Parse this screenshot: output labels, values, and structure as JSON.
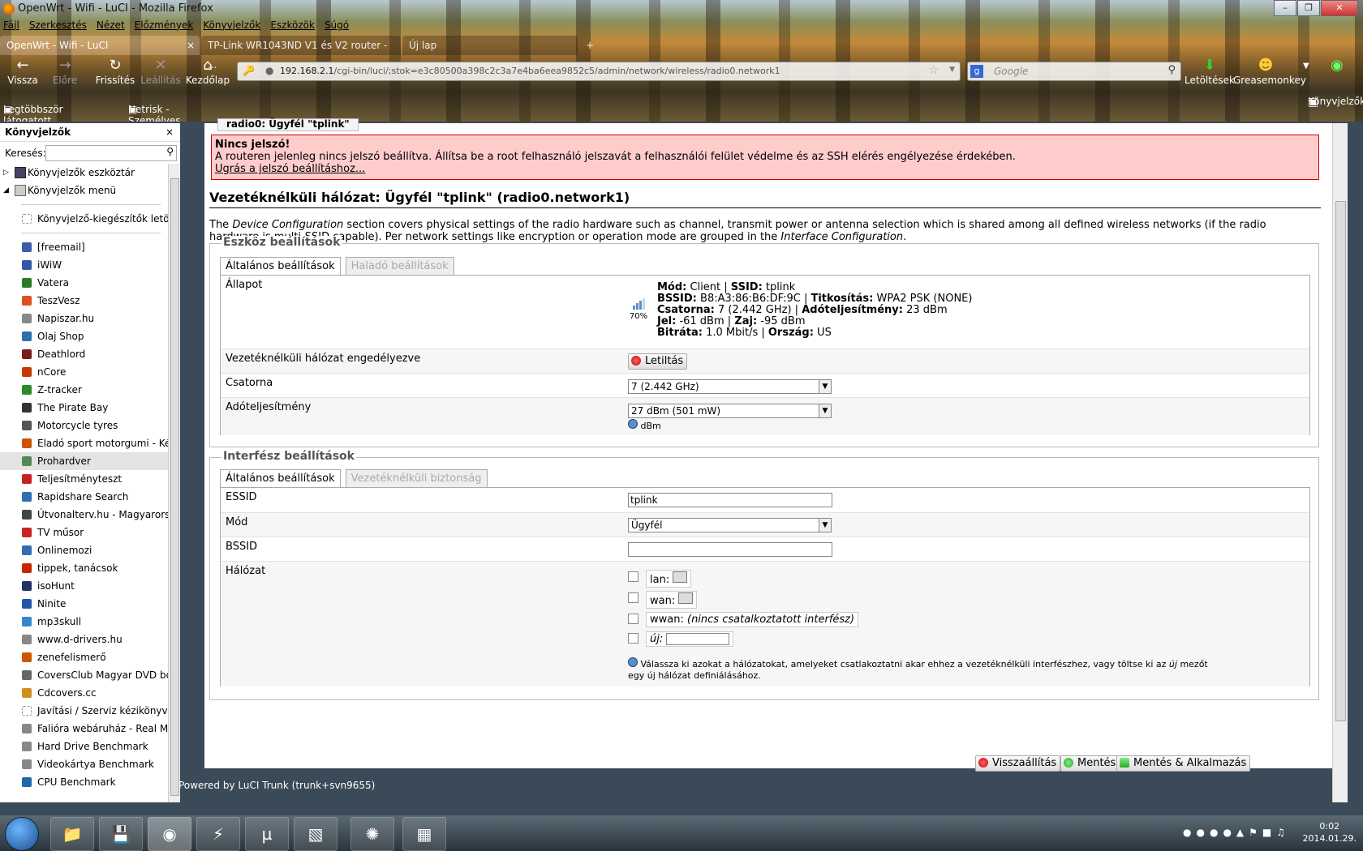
{
  "window": {
    "title": "OpenWrt - Wifi - LuCI - Mozilla Firefox"
  },
  "menu": [
    "Fájl",
    "Szerkesztés",
    "Nézet",
    "Előzmények",
    "Könyvjelzők",
    "Eszközök",
    "Súgó"
  ],
  "tabs": [
    {
      "label": "OpenWrt - Wifi - LuCI"
    },
    {
      "label": "TP-Link WR1043ND V1 és V2 router - ..."
    },
    {
      "label": "Új lap"
    }
  ],
  "nav": {
    "back": "Vissza",
    "forward": "Előre",
    "reload": "Frissítés",
    "stop": "Leállítás",
    "home": "Kezdőlap",
    "downloads": "Letöltések",
    "greasemonkey": "Greasemonkey",
    "bookmarks": "Könyvjelzők"
  },
  "url": {
    "host": "192.168.2.1",
    "path": "/cgi-bin/luci/;stok=e3c80500a398c2c3a7e4ba6eea9852c5/admin/network/wireless/radio0.network1"
  },
  "search": {
    "placeholder": "Google"
  },
  "bookmarks_bar": [
    "Legtöbbször látogatott",
    "Netrisk - Személyes m..."
  ],
  "sidebar": {
    "title": "Könyvjelzők",
    "search_label": "Keresés:",
    "folders": [
      "Könyvjelzők eszköztár",
      "Könyvjelzők menü"
    ],
    "top_item": "Könyvjelző-kiegészítők letölt...",
    "items": [
      "[freemail]",
      "iWiW",
      "Vatera",
      "TeszVesz",
      "Napiszar.hu",
      "Olaj Shop",
      "Deathlord",
      "nCore",
      "Z-tracker",
      "The Pirate Bay",
      "Motorcycle tyres",
      "Eladó sport motorgumi - Ké...",
      "Prohardver",
      "Teljesítményteszt",
      "Rapidshare Search",
      "Útvonalterv.hu - Magyarorsz...",
      "TV műsor",
      "Onlinemozi",
      "tippek, tanácsok",
      "isoHunt",
      "Ninite",
      "mp3skull",
      "www.d-drivers.hu",
      "zenefelismerő",
      "CoversClub Magyar DVD bo...",
      "Cdcovers.cc",
      "Javítási / Szerviz kézikönyvek...",
      "Falióra webáruház - Real Ma...",
      "Hard Drive Benchmark",
      "Videokártya Benchmark",
      "CPU Benchmark"
    ],
    "item_colors": [
      "#3a5ea8",
      "#3355aa",
      "#2a7a2a",
      "#e05020",
      "#888888",
      "#2f6fb0",
      "#7a1a1a",
      "#c33b00",
      "#2a8a2a",
      "#333333",
      "#555555",
      "#cc5500",
      "#558855",
      "#c82020",
      "#2f6fb0",
      "#444444",
      "#cc2222",
      "#2f6fb0",
      "#cc2200",
      "#223366",
      "#2255aa",
      "#3388cc",
      "#888888",
      "#cc5500",
      "#666666",
      "#d09020",
      "#ffffff",
      "#888888",
      "#888888",
      "#888888",
      "#2266aa"
    ]
  },
  "luci": {
    "radio_tab": "radio0: Ügyfél \"tplink\"",
    "alert_title": "Nincs jelszó!",
    "alert_text": "A routeren jelenleg nincs jelszó beállítva. Állítsa be a root felhasználó jelszavát a felhasználói felület védelme és az SSH elérés engélyezése érdekében.",
    "alert_link": "Ugrás a jelszó beállításhoz...",
    "heading": "Vezetéknélküli hálózat: Ügyfél \"tplink\" (radio0.network1)",
    "desc_1": "The ",
    "desc_em1": "Device Configuration",
    "desc_2": " section covers physical settings of the radio hardware such as channel, transmit power or antenna selection which is shared among all defined wireless networks (if the radio hardware is multi-SSID capable). Per network settings like encryption or operation mode are grouped in the ",
    "desc_em2": "Interface Configuration",
    "desc_3": ".",
    "device_legend": "Eszköz beállítások",
    "device_tabs": [
      "Általános beállítások",
      "Haladó beállítások"
    ],
    "status_label": "Állapot",
    "signal_pct": "70%",
    "status_lines": [
      [
        {
          "k": "Mód:",
          "v": " Client | "
        },
        {
          "k": "SSID:",
          "v": " tplink"
        }
      ],
      [
        {
          "k": "BSSID:",
          "v": " B8:A3:86:B6:DF:9C | "
        },
        {
          "k": "Titkosítás:",
          "v": " WPA2 PSK (NONE)"
        }
      ],
      [
        {
          "k": "Csatorna:",
          "v": " 7 (2.442 GHz) | "
        },
        {
          "k": "Adóteljesítmény:",
          "v": " 23 dBm"
        }
      ],
      [
        {
          "k": "Jel:",
          "v": " -61 dBm | "
        },
        {
          "k": "Zaj:",
          "v": " -95 dBm"
        }
      ],
      [
        {
          "k": "Bitráta:",
          "v": " 1.0 Mbit/s | "
        },
        {
          "k": "Ország:",
          "v": " US"
        }
      ]
    ],
    "enable_label": "Vezetéknélküli hálózat engedélyezve",
    "disable_button": "Letiltás",
    "channel_label": "Csatorna",
    "channel_value": "7 (2.442 GHz)",
    "txpower_label": "Adóteljesítmény",
    "txpower_value": "27 dBm (501 mW)",
    "txpower_unit": "dBm",
    "iface_legend": "Interfész beállítások",
    "iface_tabs": [
      "Általános beállítások",
      "Vezetéknélküli biztonság"
    ],
    "essid_label": "ESSID",
    "essid_value": "tplink",
    "mode_label": "Mód",
    "mode_value": "Ügyfél",
    "bssid_label": "BSSID",
    "bssid_value": "",
    "network_label": "Hálózat",
    "networks": [
      {
        "name": "lan:"
      },
      {
        "name": "wan:"
      },
      {
        "name": "wwan:",
        "note": "(nincs csatalkoztatott interfész)"
      }
    ],
    "new_label": "új:",
    "network_hint_1": "Válassza ki azokat a hálózatokat, amelyeket csatlakoztatni akar ehhez a vezetéknélküli interfészhez, vagy töltse ki az ",
    "network_hint_em": "új",
    "network_hint_2": " mezőt egy új hálózat definiálásához.",
    "reset_button": "Visszaállítás",
    "save_button": "Mentés",
    "apply_button": "Mentés & Alkalmazás",
    "powered": "Powered by LuCI Trunk (trunk+svn9655)"
  },
  "clock": {
    "time": "0:02",
    "date": "2014.01.29."
  }
}
